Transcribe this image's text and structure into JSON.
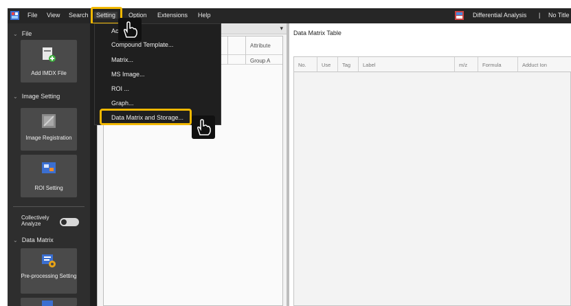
{
  "menubar": {
    "items": [
      "File",
      "View",
      "Search",
      "Setting",
      "Option",
      "Extensions",
      "Help"
    ],
    "mode_label": "Differential Analysis",
    "separator": "|",
    "project_title": "No Title"
  },
  "sidebar": {
    "file_header": "File",
    "add_imdx": "Add IMDX File",
    "image_setting_header": "Image Setting",
    "image_registration": "Image Registration",
    "roi_setting": "ROI Setting",
    "collectively_analyze": "Collectively Analyze",
    "data_matrix_header": "Data Matrix",
    "preprocessing": "Pre-processing Setting"
  },
  "middle_panel": {
    "attribute_header": "Attribute",
    "attribute_value": "Group A"
  },
  "data_matrix": {
    "title": "Data Matrix Table",
    "columns": [
      "No.",
      "Use",
      "Tag",
      "Label",
      "m/z",
      "Formula",
      "Adduct Ion"
    ]
  },
  "setting_menu": {
    "items": [
      "Ac...",
      "Compound Template...",
      "Matrix...",
      "MS Image...",
      "ROI ...",
      "Graph...",
      "Data Matrix and Storage..."
    ],
    "highlighted_item": "Data Matrix and Storage..."
  },
  "colors": {
    "highlight": "#f2b800",
    "menubar_bg": "#262626",
    "sidebar_bg": "#2e2e2e",
    "menu_bg": "#1f1f1f"
  }
}
